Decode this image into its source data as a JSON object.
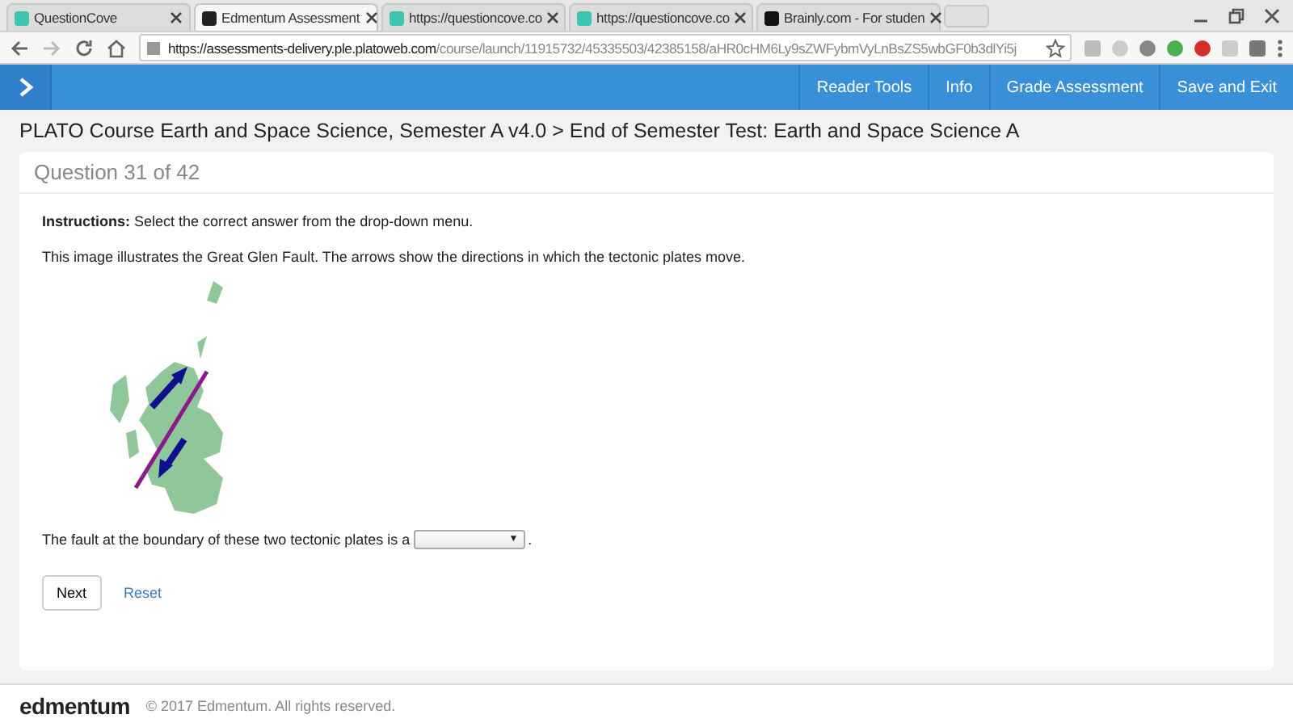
{
  "browser": {
    "tabs": [
      {
        "title": "QuestionCove",
        "selected": false,
        "kind": "cove"
      },
      {
        "title": "Edmentum Assessment",
        "selected": true,
        "kind": "edm"
      },
      {
        "title": "https://questioncove.co",
        "selected": false,
        "kind": "cove"
      },
      {
        "title": "https://questioncove.co",
        "selected": false,
        "kind": "cove"
      },
      {
        "title": "Brainly.com - For studen",
        "selected": false,
        "kind": "brainly"
      }
    ],
    "url_host": "https://assessments-delivery.ple.platoweb.com",
    "url_path": "/course/launch/11915732/45335503/42385158/aHR0cHM6Ly9sZWFybmVyLnBsZS5wbGF0b3dlYi5j"
  },
  "toolbar": {
    "items": [
      "Reader Tools",
      "Info",
      "Grade Assessment",
      "Save and Exit"
    ]
  },
  "breadcrumb": "PLATO Course Earth and Space Science, Semester A v4.0 > End of Semester Test: Earth and Space Science A",
  "question": {
    "title": "Question 31 of 42",
    "instructions": "**Instructions:** Select the correct answer from the drop-down menu.",
    "text": "This image illustrates the Great Glen Fault. The arrows show the directions in which the tectonic plates move.",
    "prompt": "The fault at the boundary of these two tectonic plates is a",
    "prompt_end": ".",
    "dropdown_caret": "▼"
  },
  "buttons": {
    "next": "Next",
    "reset": "Reset"
  },
  "footer": {
    "logo": "edmentum",
    "copyright": "© 2017 Edmentum. All rights reserved."
  }
}
